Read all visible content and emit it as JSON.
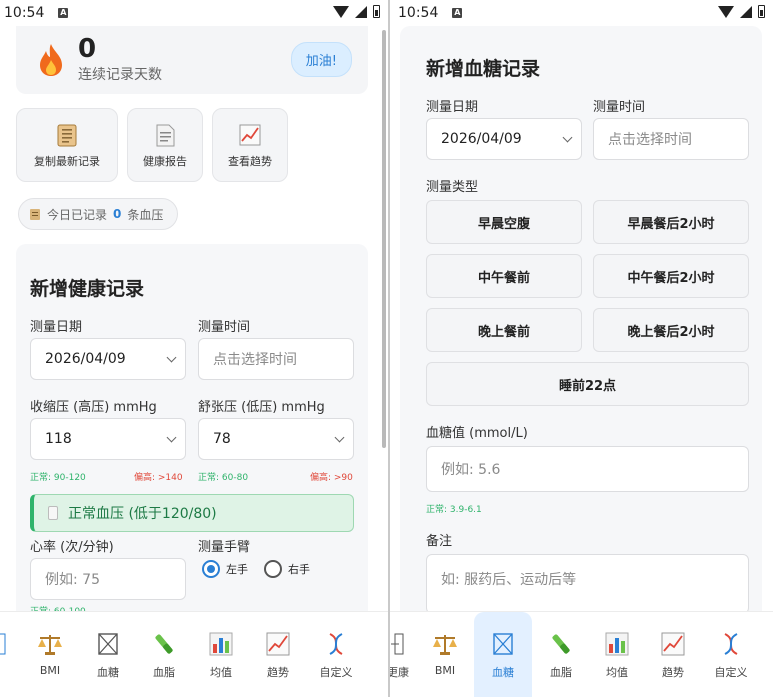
{
  "left": {
    "status": {
      "time": "10:54"
    },
    "streak": {
      "value": "0",
      "label": "连续记录天数",
      "cheer": "加油!"
    },
    "quick_actions": [
      {
        "label": "复制最新记录",
        "icon": "clipboard-icon"
      },
      {
        "label": "健康报告",
        "icon": "document-icon"
      },
      {
        "label": "查看趋势",
        "icon": "trend-chart-icon"
      }
    ],
    "today": {
      "prefix": "今日已记录",
      "count": "0",
      "suffix": "条血压"
    },
    "form": {
      "title": "新增健康记录",
      "date_label": "测量日期",
      "date_value": "2026/04/09",
      "time_label": "测量时间",
      "time_placeholder": "点击选择时间",
      "systolic_label": "收缩压 (高压) mmHg",
      "systolic_value": "118",
      "diastolic_label": "舒张压 (低压) mmHg",
      "diastolic_value": "78",
      "systolic_normal": "正常: 90-120",
      "systolic_high": "偏高: >140",
      "diastolic_normal": "正常: 60-80",
      "diastolic_high": "偏高: >90",
      "bp_status": "正常血压 (低于120/80)",
      "hr_label": "心率 (次/分钟)",
      "hr_placeholder": "例如: 75",
      "hr_normal": "正常: 60-100",
      "arm_label": "测量手臂",
      "arm_left": "左手",
      "arm_right": "右手"
    },
    "nav": [
      {
        "label": "",
        "icon": "partial-icon"
      },
      {
        "label": "BMI",
        "icon": "scale-icon"
      },
      {
        "label": "血糖",
        "icon": "glucose-icon"
      },
      {
        "label": "血脂",
        "icon": "lipid-icon"
      },
      {
        "label": "均值",
        "icon": "bar-chart-icon"
      },
      {
        "label": "趋势",
        "icon": "trend-chart-icon"
      },
      {
        "label": "自定义",
        "icon": "custom-dna-icon"
      }
    ]
  },
  "right": {
    "status": {
      "time": "10:54"
    },
    "form": {
      "title": "新增血糖记录",
      "date_label": "测量日期",
      "date_value": "2026/04/09",
      "time_label": "测量时间",
      "time_placeholder": "点击选择时间",
      "type_label": "测量类型",
      "types": [
        "早晨空腹",
        "早晨餐后2小时",
        "中午餐前",
        "中午餐后2小时",
        "晚上餐前",
        "晚上餐后2小时",
        "睡前22点"
      ],
      "glucose_label": "血糖值 (mmol/L)",
      "glucose_placeholder": "例如: 5.6",
      "glucose_normal": "正常: 3.9-6.1",
      "note_label": "备注",
      "note_placeholder": "如: 服药后、运动后等"
    },
    "nav": [
      {
        "label": "更康",
        "icon": "partial-icon"
      },
      {
        "label": "BMI",
        "icon": "scale-icon"
      },
      {
        "label": "血糖",
        "icon": "glucose-icon",
        "active": true
      },
      {
        "label": "血脂",
        "icon": "lipid-icon"
      },
      {
        "label": "均值",
        "icon": "bar-chart-icon"
      },
      {
        "label": "趋势",
        "icon": "trend-chart-icon"
      },
      {
        "label": "自定义",
        "icon": "custom-dna-icon"
      }
    ]
  },
  "colors": {
    "accent": "#2a7fd4",
    "normal": "#2fb36b",
    "warning": "#e0483a",
    "fire": "#f06a1c"
  }
}
